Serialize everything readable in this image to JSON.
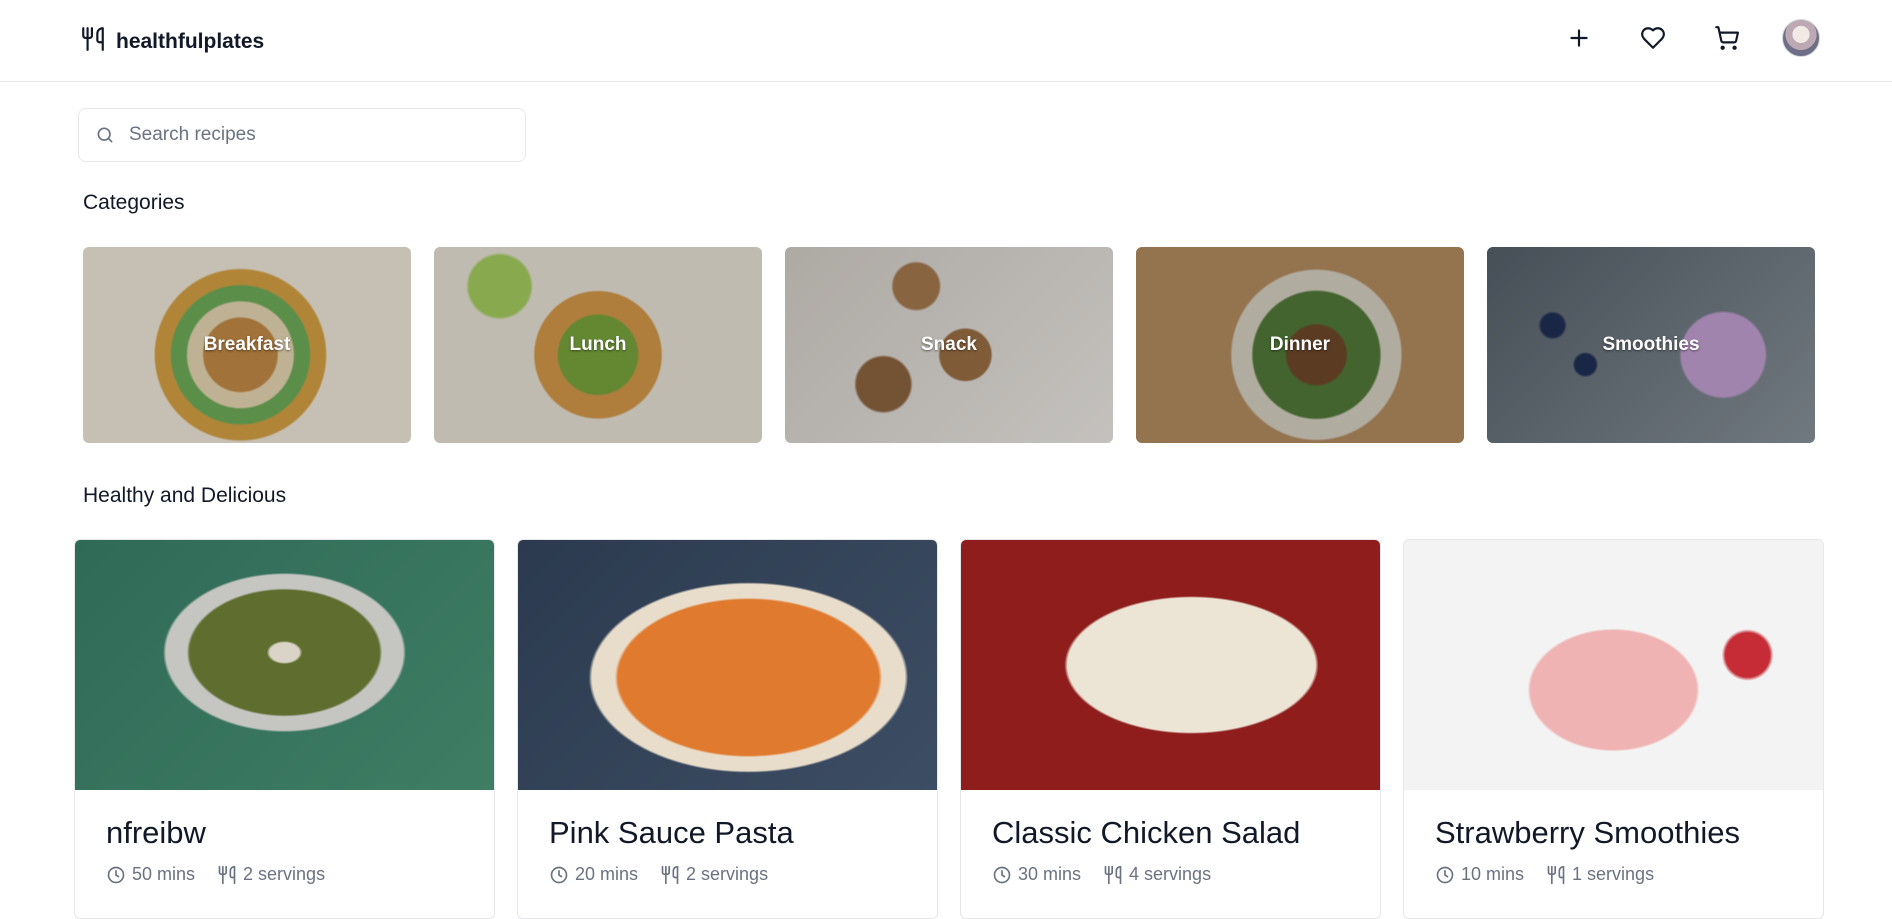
{
  "brand": {
    "name": "healthfulplates",
    "icon": "utensils-icon"
  },
  "header_actions": [
    {
      "name": "add-recipe-button",
      "icon": "plus-icon"
    },
    {
      "name": "favorites-button",
      "icon": "heart-icon"
    },
    {
      "name": "cart-button",
      "icon": "cart-icon"
    }
  ],
  "search": {
    "placeholder": "Search recipes",
    "value": ""
  },
  "categories_section": {
    "title": "Categories",
    "items": [
      {
        "label": "Breakfast"
      },
      {
        "label": "Lunch"
      },
      {
        "label": "Snack"
      },
      {
        "label": "Dinner"
      },
      {
        "label": "Smoothies"
      }
    ]
  },
  "recipes_section": {
    "title": "Healthy and Delicious",
    "items": [
      {
        "title": "nfreibw",
        "time": "50 mins",
        "servings": "2 servings"
      },
      {
        "title": "Pink Sauce Pasta",
        "time": "20 mins",
        "servings": "2 servings"
      },
      {
        "title": "Classic Chicken Salad",
        "time": "30 mins",
        "servings": "4 servings"
      },
      {
        "title": "Strawberry Smoothies",
        "time": "10 mins",
        "servings": "1 servings"
      }
    ]
  },
  "colors": {
    "text": "#111827",
    "muted": "#6b7280",
    "border": "#e5e7eb"
  }
}
